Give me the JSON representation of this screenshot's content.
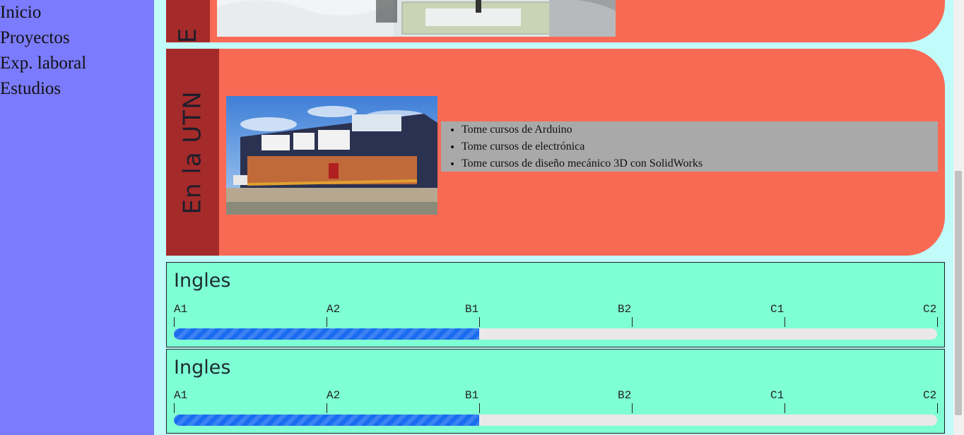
{
  "nav": {
    "items": [
      {
        "label": "Inicio"
      },
      {
        "label": "Proyectos"
      },
      {
        "label": "Exp. laboral"
      },
      {
        "label": "Estudios"
      }
    ]
  },
  "studies": {
    "top_card": {
      "label": "E"
    },
    "utn_card": {
      "label": "En la UTN",
      "items": [
        "Tome cursos de Arduino",
        "Tome cursos de electrónica",
        "Tome cursos de diseño mecánico 3D con SolidWorks"
      ]
    }
  },
  "languages": [
    {
      "title": "Ingles",
      "levels": [
        "A1",
        "A2",
        "B1",
        "B2",
        "C1",
        "C2"
      ],
      "progress_fraction": 0.4
    },
    {
      "title": "Ingles",
      "levels": [
        "A1",
        "A2",
        "B1",
        "B2",
        "C1",
        "C2"
      ],
      "progress_fraction": 0.4
    }
  ],
  "colors": {
    "page_bg": "#c1fcfa",
    "sidebar_bg": "#7b7bfd",
    "card_bg": "#f96a55",
    "card_label_bg": "#a52a2a",
    "list_bg": "#a9a9a9",
    "lang_bg": "#7fffd4",
    "progress_fill": "#1a6cf0"
  }
}
